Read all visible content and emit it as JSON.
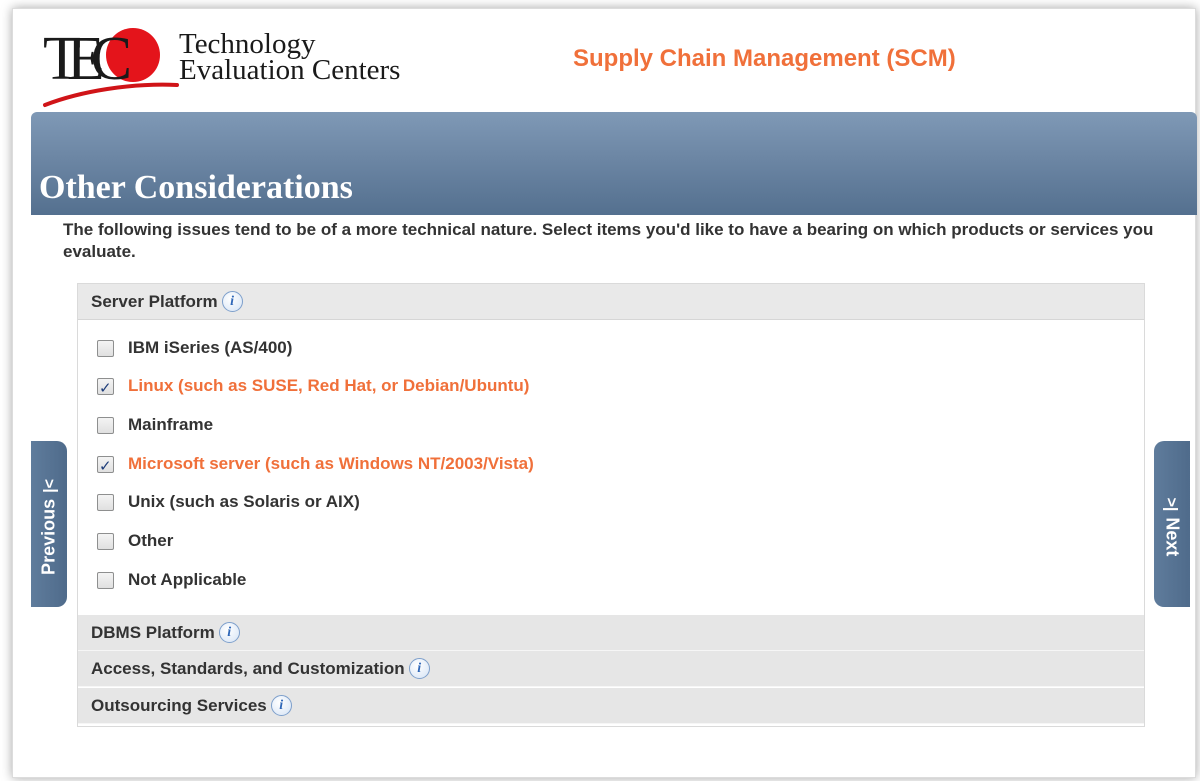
{
  "header": {
    "logo_line1": "Technology",
    "logo_line2": "Evaluation Centers",
    "logo_letters": "TEC",
    "app_title": "Supply Chain Management (SCM)"
  },
  "page": {
    "title": "Other Considerations",
    "intro": "The following issues tend to be of a more technical nature. Select items you'd like to have a bearing on which products or services you evaluate."
  },
  "sections": [
    {
      "label": "Server Platform",
      "expanded": true,
      "options": [
        {
          "label": "IBM iSeries (AS/400)",
          "checked": false
        },
        {
          "label": "Linux (such as SUSE, Red Hat, or Debian/Ubuntu)",
          "checked": true
        },
        {
          "label": "Mainframe",
          "checked": false
        },
        {
          "label": "Microsoft server (such as Windows NT/2003/Vista)",
          "checked": true
        },
        {
          "label": "Unix (such as Solaris or AIX)",
          "checked": false
        },
        {
          "label": "Other",
          "checked": false
        },
        {
          "label": "Not Applicable",
          "checked": false
        }
      ]
    },
    {
      "label": "DBMS Platform",
      "expanded": false
    },
    {
      "label": "Access, Standards, and Customization",
      "expanded": false
    },
    {
      "label": "Outsourcing Services",
      "expanded": false
    }
  ],
  "nav": {
    "previous_label": "Previous",
    "next_label": "Next",
    "previous_icon": "chevron-left-icon",
    "next_icon": "chevron-right-icon"
  },
  "colors": {
    "accent_orange": "#f0703a",
    "banner_blue": "#6c86a4",
    "logo_red": "#e4141b"
  }
}
